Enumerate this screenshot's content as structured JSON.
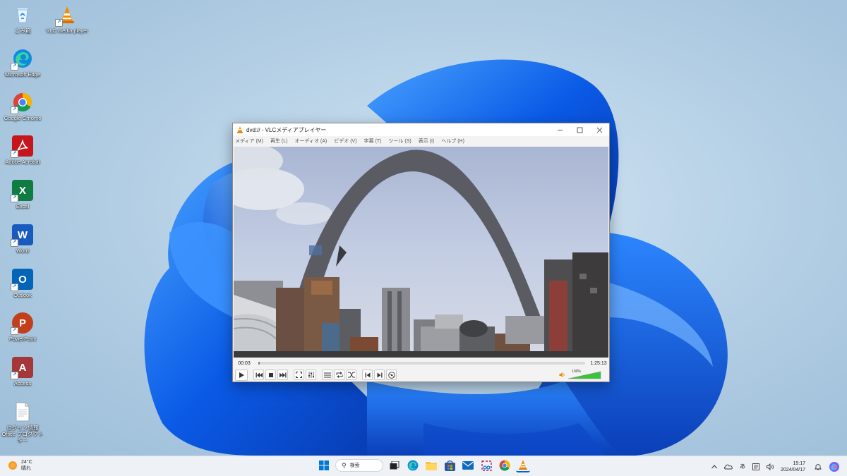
{
  "desktop": {
    "icons": [
      {
        "label": "ごみ箱",
        "icon": "recycle-bin-icon"
      },
      {
        "label": "VLC media player",
        "icon": "vlc-cone-icon"
      },
      {
        "label": "Microsoft Edge",
        "icon": "edge-icon"
      },
      {
        "label": "Google Chrome",
        "icon": "chrome-icon"
      },
      {
        "label": "Adobe Acrobat",
        "icon": "acrobat-icon"
      },
      {
        "label": "Excel",
        "icon": "excel-icon"
      },
      {
        "label": "Word",
        "icon": "word-icon"
      },
      {
        "label": "Outlook",
        "icon": "outlook-icon"
      },
      {
        "label": "PowerPoint",
        "icon": "powerpoint-icon"
      },
      {
        "label": "Access",
        "icon": "access-icon"
      },
      {
        "label": "ログイン情報 Office プロダクトキー",
        "icon": "document-icon"
      }
    ]
  },
  "vlc": {
    "title": "dvd:// - VLCメディアプレイヤー",
    "menu": [
      "メディア (M)",
      "再生 (L)",
      "オーディオ (A)",
      "ビデオ (V)",
      "字幕 (T)",
      "ツール (S)",
      "表示 (I)",
      "ヘルプ (H)"
    ],
    "elapsed": "00:03",
    "total": "1:25:13",
    "progress": 0.0006,
    "volume_percent": "100%",
    "volume_level": 1.0
  },
  "taskbar": {
    "weather_temp": "24°C",
    "weather_desc": "晴れ",
    "search_label": "検索",
    "ime": "あ",
    "time": "15:17",
    "date": "2024/04/17"
  },
  "colors": {
    "accent": "#0067c0",
    "vlc_orange": "#f28c00",
    "volume_green": "#3cc23c"
  }
}
